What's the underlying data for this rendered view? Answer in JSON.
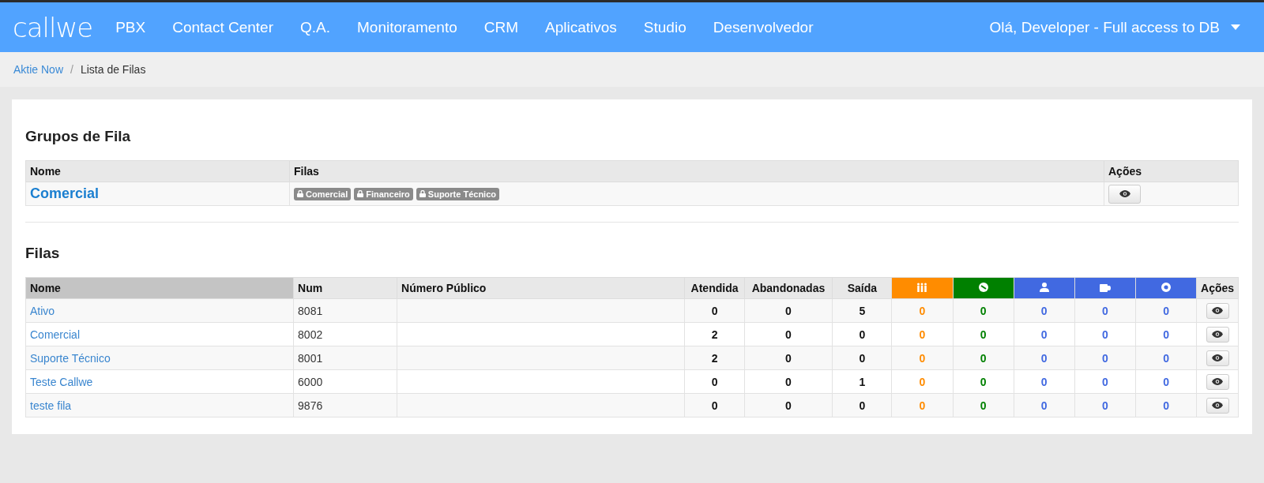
{
  "navbar": {
    "logo": "callwe",
    "items": [
      "PBX",
      "Contact Center",
      "Q.A.",
      "Monitoramento",
      "CRM",
      "Aplicativos",
      "Studio",
      "Desenvolvedor"
    ],
    "user_menu": "Olá, Developer - Full access to DB"
  },
  "breadcrumb": {
    "separator": "/",
    "items": [
      {
        "label": "Aktie Now",
        "kind": "link"
      },
      {
        "label": "Lista de Filas",
        "kind": "current"
      }
    ]
  },
  "groups": {
    "title": "Grupos de Fila",
    "columns": [
      "Nome",
      "Filas",
      "Ações"
    ],
    "rows": [
      {
        "name": "Comercial",
        "queues": [
          "Comercial",
          "Financeiro",
          "Suporte Técnico"
        ]
      }
    ]
  },
  "queues": {
    "title": "Filas",
    "columns": [
      {
        "label": "Nome",
        "kind": "link",
        "sorted": true
      },
      {
        "label": "Num",
        "kind": "text",
        "sorted": false
      },
      {
        "label": "Número Público",
        "kind": "text",
        "sorted": false
      },
      {
        "label": "Atendida",
        "kind": "count",
        "sorted": false
      },
      {
        "label": "Abandonadas",
        "kind": "count",
        "sorted": false
      },
      {
        "label": "Saída",
        "kind": "count",
        "sorted": false
      },
      {
        "kind": "status",
        "color": "#ff8c00",
        "sorted": false
      },
      {
        "kind": "status",
        "color": "#008000",
        "sorted": false
      },
      {
        "kind": "status",
        "color": "#4169e1",
        "sorted": false
      },
      {
        "kind": "status",
        "color": "#4169e1",
        "sorted": false
      },
      {
        "kind": "status",
        "color": "#4169e1",
        "sorted": false
      },
      {
        "label": "Ações",
        "kind": "actions",
        "sorted": false
      }
    ],
    "rows": [
      {
        "cells": [
          "Ativo",
          "8081",
          null,
          "0",
          "0",
          "5",
          "0",
          "0",
          "0",
          "0",
          "0"
        ]
      },
      {
        "cells": [
          "Comercial",
          "8002",
          null,
          "2",
          "0",
          "0",
          "0",
          "0",
          "0",
          "0",
          "0"
        ]
      },
      {
        "cells": [
          "Suporte Técnico",
          "8001",
          null,
          "2",
          "0",
          "0",
          "0",
          "0",
          "0",
          "0",
          "0"
        ]
      },
      {
        "cells": [
          "Teste Callwe",
          "6000",
          null,
          "0",
          "0",
          "1",
          "0",
          "0",
          "0",
          "0",
          "0"
        ]
      },
      {
        "cells": [
          "teste fila",
          "9876",
          null,
          "0",
          "0",
          "0",
          "0",
          "0",
          "0",
          "0",
          "0"
        ]
      }
    ]
  }
}
